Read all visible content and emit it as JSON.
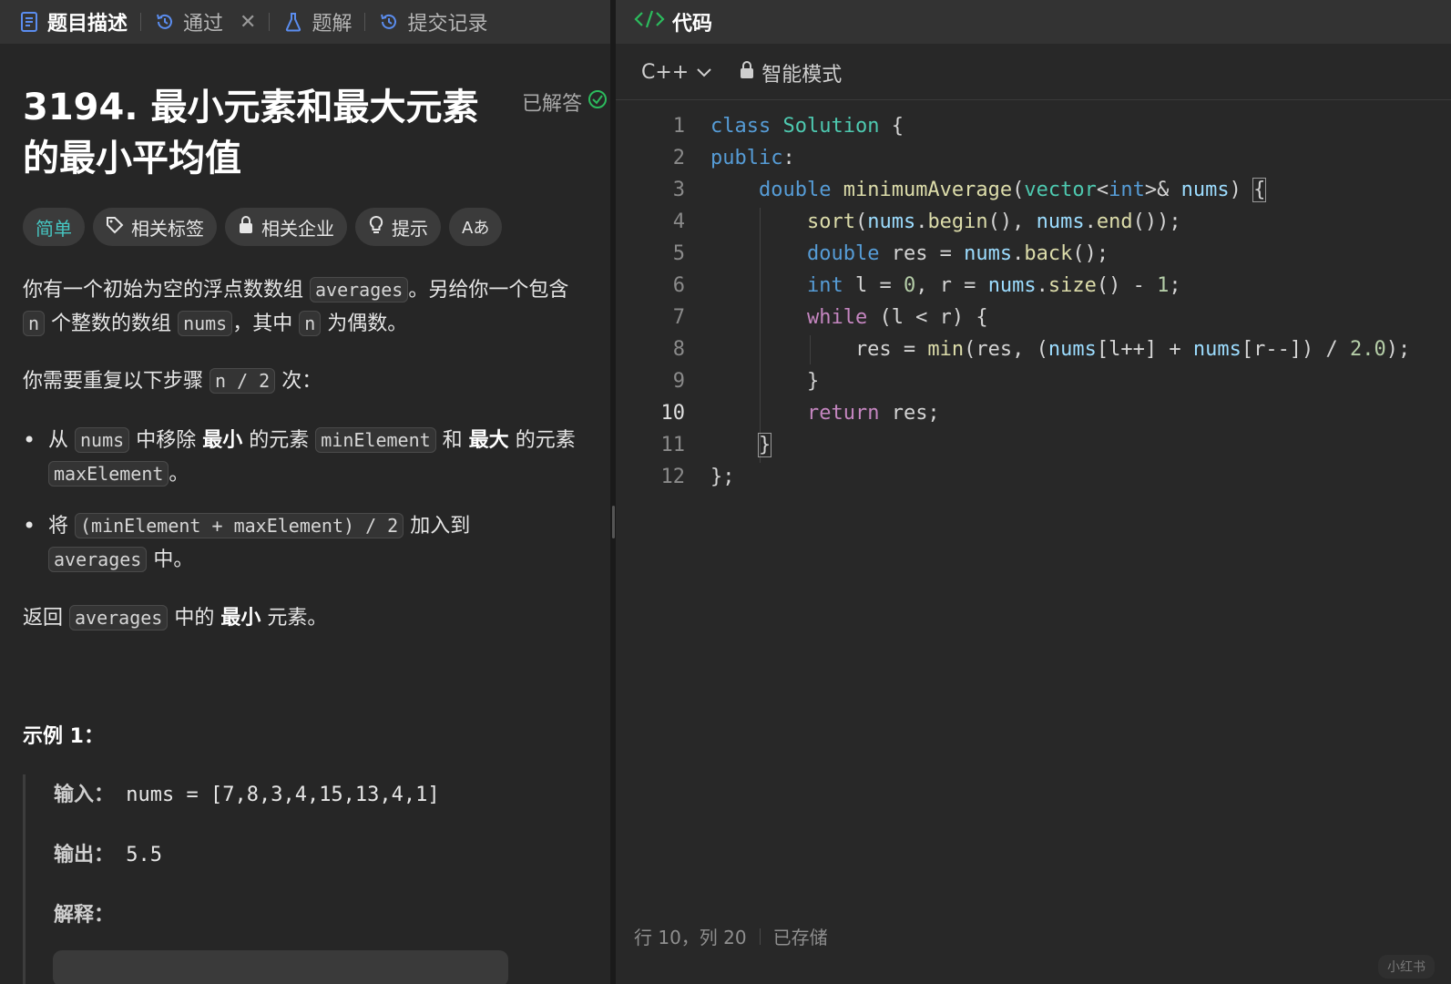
{
  "left_tabs": [
    {
      "label": "题目描述",
      "icon": "document-icon",
      "active": true
    },
    {
      "label": "通过",
      "icon": "history-icon",
      "active": false
    },
    {
      "label": "题解",
      "icon": "flask-icon",
      "active": false
    },
    {
      "label": "提交记录",
      "icon": "history-icon",
      "active": false
    }
  ],
  "problem": {
    "title": "3194. 最小元素和最大元素的最小平均值",
    "solved_label": "已解答",
    "difficulty": "简单",
    "chips": [
      "相关标签",
      "相关企业",
      "提示",
      "Aあ"
    ],
    "p1_a": "你有一个初始为空的浮点数数组",
    "p1_code1": "averages",
    "p1_b": "。另给你一个包含",
    "p1_code2": "n",
    "p1_c": "个整数的数组",
    "p1_code3": "nums",
    "p1_d": "，其中",
    "p1_code4": "n",
    "p1_e": "为偶数。",
    "p2_a": "你需要重复以下步骤",
    "p2_code": "n / 2",
    "p2_b": "次：",
    "b1_a": "从",
    "b1_code1": "nums",
    "b1_b": "中移除",
    "b1_bold1": "最小",
    "b1_c": "的元素",
    "b1_code2": "minElement",
    "b1_d": "和",
    "b1_bold2": "最大",
    "b1_e": "的元素",
    "b1_code3": "maxElement",
    "b1_f": "。",
    "b2_a": "将",
    "b2_code1": "(minElement + maxElement) / 2",
    "b2_b": "加入到",
    "b2_code2": "averages",
    "b2_c": "中。",
    "p3_a": "返回",
    "p3_code": "averages",
    "p3_b": "中的",
    "p3_bold": "最小",
    "p3_c": "元素。",
    "example_title": "示例 1：",
    "example_input_label": "输入：",
    "example_input": "nums = [7,8,3,4,15,13,4,1]",
    "example_output_label": "输出：",
    "example_output": "5.5",
    "example_explain_label": "解释："
  },
  "editor": {
    "header_label": "代码",
    "language": "C++",
    "mode_label": "智能模式",
    "line_numbers": [
      "1",
      "2",
      "3",
      "4",
      "5",
      "6",
      "7",
      "8",
      "9",
      "10",
      "11",
      "12"
    ],
    "current_line": 10,
    "status_position": "行 10，列 20",
    "status_saved": "已存储"
  },
  "watermark": "小红书",
  "colors": {
    "easy": "#46c6c2",
    "solved_check": "#2cbb5d",
    "code_icon": "#2cbb5d"
  }
}
